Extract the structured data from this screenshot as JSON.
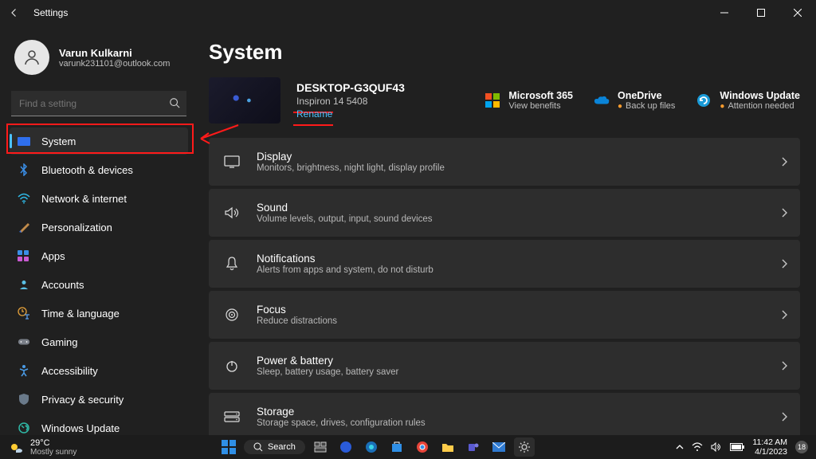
{
  "titlebar": {
    "title": "Settings"
  },
  "user": {
    "name": "Varun Kulkarni",
    "email": "varunk231101@outlook.com"
  },
  "search": {
    "placeholder": "Find a setting"
  },
  "nav": {
    "items": [
      {
        "label": "System",
        "icon": "monitor-icon",
        "selected": true
      },
      {
        "label": "Bluetooth & devices",
        "icon": "bluetooth-icon"
      },
      {
        "label": "Network & internet",
        "icon": "wifi-icon"
      },
      {
        "label": "Personalization",
        "icon": "paintbrush-icon"
      },
      {
        "label": "Apps",
        "icon": "grid-icon"
      },
      {
        "label": "Accounts",
        "icon": "person-icon"
      },
      {
        "label": "Time & language",
        "icon": "clock-lang-icon"
      },
      {
        "label": "Gaming",
        "icon": "gamepad-icon"
      },
      {
        "label": "Accessibility",
        "icon": "accessibility-icon"
      },
      {
        "label": "Privacy & security",
        "icon": "shield-icon"
      },
      {
        "label": "Windows Update",
        "icon": "update-icon"
      }
    ]
  },
  "page": {
    "title": "System",
    "device": {
      "name": "DESKTOP-G3QUF43",
      "model": "Inspiron 14 5408",
      "rename": "Rename"
    },
    "promos": [
      {
        "title": "Microsoft 365",
        "sub": "View benefits",
        "icon": "m365-icon"
      },
      {
        "title": "OneDrive",
        "sub": "Back up files",
        "icon": "cloud-icon",
        "dot": true
      },
      {
        "title": "Windows Update",
        "sub": "Attention needed",
        "icon": "update-icon",
        "dot": true
      }
    ],
    "cards": [
      {
        "title": "Display",
        "sub": "Monitors, brightness, night light, display profile",
        "icon": "display-icon"
      },
      {
        "title": "Sound",
        "sub": "Volume levels, output, input, sound devices",
        "icon": "sound-icon"
      },
      {
        "title": "Notifications",
        "sub": "Alerts from apps and system, do not disturb",
        "icon": "bell-icon"
      },
      {
        "title": "Focus",
        "sub": "Reduce distractions",
        "icon": "focus-icon"
      },
      {
        "title": "Power & battery",
        "sub": "Sleep, battery usage, battery saver",
        "icon": "power-icon"
      },
      {
        "title": "Storage",
        "sub": "Storage space, drives, configuration rules",
        "icon": "storage-icon"
      }
    ]
  },
  "taskbar": {
    "weather": {
      "temp": "29°C",
      "cond": "Mostly sunny"
    },
    "search": "Search",
    "time": "11:42 AM",
    "date": "4/1/2023",
    "notif_count": "18"
  }
}
